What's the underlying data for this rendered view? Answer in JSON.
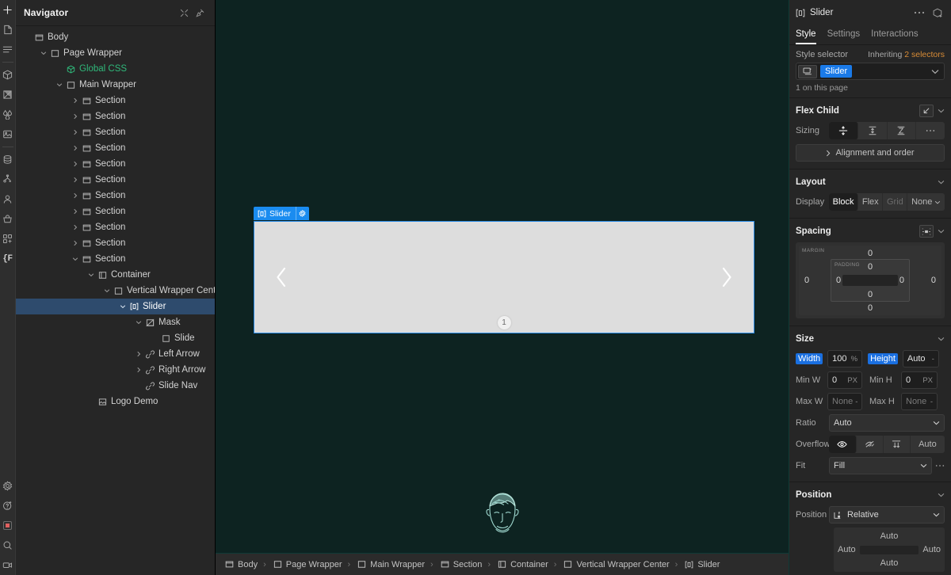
{
  "rail": {
    "top_items": [
      {
        "name": "add-panel-icon",
        "title": "Add elements"
      },
      {
        "name": "pages-icon",
        "title": "Pages"
      },
      {
        "name": "navigator-icon",
        "title": "Navigator"
      },
      {
        "name": "components-icon",
        "title": "Components"
      },
      {
        "name": "style-manager-icon",
        "title": "Style manager"
      },
      {
        "name": "variables-icon",
        "title": "Variables"
      },
      {
        "name": "assets-icon",
        "title": "Assets"
      },
      {
        "name": "cms-icon",
        "title": "CMS"
      },
      {
        "name": "logic-icon",
        "title": "Logic"
      },
      {
        "name": "users-icon",
        "title": "Users"
      },
      {
        "name": "ecommerce-icon",
        "title": "Ecommerce"
      },
      {
        "name": "apps-icon",
        "title": "Apps"
      },
      {
        "name": "custom-code-icon",
        "title": "{F"
      }
    ],
    "bottom_items": [
      {
        "name": "settings-gear-icon",
        "title": "Settings"
      },
      {
        "name": "help-icon",
        "title": "Help"
      },
      {
        "name": "record-indicator-icon",
        "title": "Recording"
      },
      {
        "name": "search-icon",
        "title": "Search"
      },
      {
        "name": "video-icon",
        "title": "Video"
      }
    ]
  },
  "navigator": {
    "title": "Navigator",
    "collapse_all_label": "Collapse all",
    "pin_label": "Pin panel",
    "tree": [
      {
        "label": "Body",
        "depth": 0,
        "icon": "body-icon",
        "caret": "none",
        "selected": false,
        "green": false
      },
      {
        "label": "Page Wrapper",
        "depth": 1,
        "icon": "div-icon",
        "caret": "expanded",
        "selected": false,
        "green": false
      },
      {
        "label": "Global CSS",
        "depth": 2,
        "icon": "component-icon",
        "caret": "none",
        "selected": false,
        "green": true
      },
      {
        "label": "Main Wrapper",
        "depth": 2,
        "icon": "div-icon",
        "caret": "expanded",
        "selected": false,
        "green": false
      },
      {
        "label": "Section",
        "depth": 3,
        "icon": "section-icon",
        "caret": "collapsed",
        "selected": false,
        "green": false
      },
      {
        "label": "Section",
        "depth": 3,
        "icon": "section-icon",
        "caret": "collapsed",
        "selected": false,
        "green": false
      },
      {
        "label": "Section",
        "depth": 3,
        "icon": "section-icon",
        "caret": "collapsed",
        "selected": false,
        "green": false
      },
      {
        "label": "Section",
        "depth": 3,
        "icon": "section-icon",
        "caret": "collapsed",
        "selected": false,
        "green": false
      },
      {
        "label": "Section",
        "depth": 3,
        "icon": "section-icon",
        "caret": "collapsed",
        "selected": false,
        "green": false
      },
      {
        "label": "Section",
        "depth": 3,
        "icon": "section-icon",
        "caret": "collapsed",
        "selected": false,
        "green": false
      },
      {
        "label": "Section",
        "depth": 3,
        "icon": "section-icon",
        "caret": "collapsed",
        "selected": false,
        "green": false
      },
      {
        "label": "Section",
        "depth": 3,
        "icon": "section-icon",
        "caret": "collapsed",
        "selected": false,
        "green": false
      },
      {
        "label": "Section",
        "depth": 3,
        "icon": "section-icon",
        "caret": "collapsed",
        "selected": false,
        "green": false
      },
      {
        "label": "Section",
        "depth": 3,
        "icon": "section-icon",
        "caret": "collapsed",
        "selected": false,
        "green": false
      },
      {
        "label": "Section",
        "depth": 3,
        "icon": "section-icon",
        "caret": "expanded",
        "selected": false,
        "green": false
      },
      {
        "label": "Container",
        "depth": 4,
        "icon": "container-icon",
        "caret": "expanded",
        "selected": false,
        "green": false
      },
      {
        "label": "Vertical Wrapper Center",
        "depth": 5,
        "icon": "div-icon",
        "caret": "expanded",
        "selected": false,
        "green": false
      },
      {
        "label": "Slider",
        "depth": 6,
        "icon": "slider-icon",
        "caret": "expanded",
        "selected": true,
        "green": false
      },
      {
        "label": "Mask",
        "depth": 7,
        "icon": "mask-icon",
        "caret": "expanded",
        "selected": false,
        "green": false
      },
      {
        "label": "Slide",
        "depth": 8,
        "icon": "slide-icon",
        "caret": "none",
        "selected": false,
        "green": false
      },
      {
        "label": "Left Arrow",
        "depth": 7,
        "icon": "link-icon",
        "caret": "collapsed",
        "selected": false,
        "green": false
      },
      {
        "label": "Right Arrow",
        "depth": 7,
        "icon": "link-icon",
        "caret": "collapsed",
        "selected": false,
        "green": false
      },
      {
        "label": "Slide Nav",
        "depth": 7,
        "icon": "link-icon",
        "caret": "none",
        "selected": false,
        "green": false
      },
      {
        "label": "Logo Demo",
        "depth": 4,
        "icon": "image-icon",
        "caret": "none",
        "selected": false,
        "green": false
      }
    ]
  },
  "canvas": {
    "background_color": "#0d2321",
    "selection_badge": {
      "label": "Slider",
      "gear_label": "Slider settings",
      "color": "#1a8cf0"
    },
    "slider": {
      "background_color": "#dddddd",
      "left_arrow_label": "Previous slide",
      "right_arrow_label": "Next slide",
      "slide_nav": [
        "1"
      ]
    },
    "logo_demo_label": "Logo Demo"
  },
  "breadcrumbs": [
    {
      "label": "Body",
      "icon": "body-icon"
    },
    {
      "label": "Page Wrapper",
      "icon": "div-icon"
    },
    {
      "label": "Main Wrapper",
      "icon": "div-icon"
    },
    {
      "label": "Section",
      "icon": "section-icon"
    },
    {
      "label": "Container",
      "icon": "container-icon"
    },
    {
      "label": "Vertical Wrapper Center",
      "icon": "div-icon"
    },
    {
      "label": "Slider",
      "icon": "slider-icon"
    }
  ],
  "style_panel": {
    "element_name": "Slider",
    "more_label": "More options",
    "add_component_label": "Create component",
    "tabs": [
      {
        "label": "Style",
        "active": true
      },
      {
        "label": "Settings",
        "active": false
      },
      {
        "label": "Interactions",
        "active": false
      }
    ],
    "selector": {
      "label": "Style selector",
      "inheriting_prefix": "Inheriting ",
      "inheriting_count": "2 selectors",
      "chip": "Slider",
      "note": "1 on this page",
      "tag_icon": "element-tag-icon",
      "caret_icon": "chevron-down-icon"
    },
    "flex_child": {
      "title": "Flex Child",
      "sizing_label": "Sizing",
      "sizing_options": [
        {
          "name": "sizing-shrink-icon",
          "active": true
        },
        {
          "name": "sizing-grow-icon",
          "active": false
        },
        {
          "name": "sizing-fill-icon",
          "active": false
        },
        {
          "name": "sizing-more-icon",
          "active": false
        }
      ],
      "alignment_label": "Alignment and order"
    },
    "layout": {
      "title": "Layout",
      "display_label": "Display",
      "display_options": [
        {
          "label": "Block",
          "active": true,
          "disabled": false
        },
        {
          "label": "Flex",
          "active": false,
          "disabled": false
        },
        {
          "label": "Grid",
          "active": false,
          "disabled": true
        },
        {
          "label": "None",
          "active": false,
          "disabled": false
        }
      ]
    },
    "spacing": {
      "title": "Spacing",
      "margin_label": "MARGIN",
      "padding_label": "PADDING",
      "margin": {
        "top": "0",
        "right": "0",
        "bottom": "0",
        "left": "0"
      },
      "padding": {
        "top": "0",
        "right": "0",
        "bottom": "0",
        "left": "0"
      }
    },
    "size": {
      "title": "Size",
      "width_label": "Width",
      "width_value": "100",
      "width_unit": "%",
      "height_label": "Height",
      "height_value": "Auto",
      "height_unit": "-",
      "minw_label": "Min W",
      "minw_value": "0",
      "minw_unit": "PX",
      "minh_label": "Min H",
      "minh_value": "0",
      "minh_unit": "PX",
      "maxw_label": "Max W",
      "maxw_value": "None",
      "maxw_unit": "-",
      "maxh_label": "Max H",
      "maxh_value": "None",
      "maxh_unit": "-",
      "ratio_label": "Ratio",
      "ratio_value": "Auto",
      "overflow_label": "Overflow",
      "overflow_options": [
        {
          "name": "overflow-visible-icon",
          "label": "",
          "active": true
        },
        {
          "name": "overflow-hidden-icon",
          "label": "",
          "active": false
        },
        {
          "name": "overflow-scroll-icon",
          "label": "",
          "active": false
        },
        {
          "name": "overflow-auto-option",
          "label": "Auto",
          "active": false
        }
      ],
      "fit_label": "Fit",
      "fit_value": "Fill"
    },
    "position": {
      "title": "Position",
      "position_label": "Position",
      "position_value": "Relative",
      "offsets": {
        "top": "Auto",
        "right": "Auto",
        "bottom": "Auto",
        "left": "Auto"
      }
    }
  }
}
